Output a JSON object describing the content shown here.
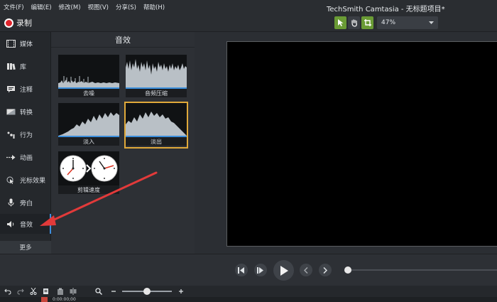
{
  "menu": [
    "文件(F)",
    "编辑(E)",
    "修改(M)",
    "视图(V)",
    "分享(S)",
    "帮助(H)"
  ],
  "app_title": "TechSmith Camtasia - 无标题项目*",
  "toolbar": {
    "record_label": "录制",
    "zoom_value": "47%"
  },
  "sidebar": {
    "items": [
      {
        "label": "媒体",
        "icon": "film-icon"
      },
      {
        "label": "库",
        "icon": "library-icon"
      },
      {
        "label": "注释",
        "icon": "annotation-icon"
      },
      {
        "label": "转换",
        "icon": "transition-icon"
      },
      {
        "label": "行为",
        "icon": "behavior-icon"
      },
      {
        "label": "动画",
        "icon": "animation-icon"
      },
      {
        "label": "光标效果",
        "icon": "cursor-effect-icon"
      },
      {
        "label": "旁白",
        "icon": "microphone-icon"
      },
      {
        "label": "音效",
        "icon": "speaker-icon"
      }
    ],
    "more_label": "更多"
  },
  "panel": {
    "title": "音效",
    "tiles": [
      {
        "label": "去噪"
      },
      {
        "label": "音频压缩"
      },
      {
        "label": "淡入"
      },
      {
        "label": "淡出"
      },
      {
        "label": "剪辑速度"
      }
    ]
  },
  "timeline": {
    "timecode": "0:00:00;00"
  },
  "colors": {
    "accent": "#6a9b35",
    "record": "#e0242b",
    "selection": "#e0a93a",
    "annotation_arrow": "#e23a3a"
  }
}
